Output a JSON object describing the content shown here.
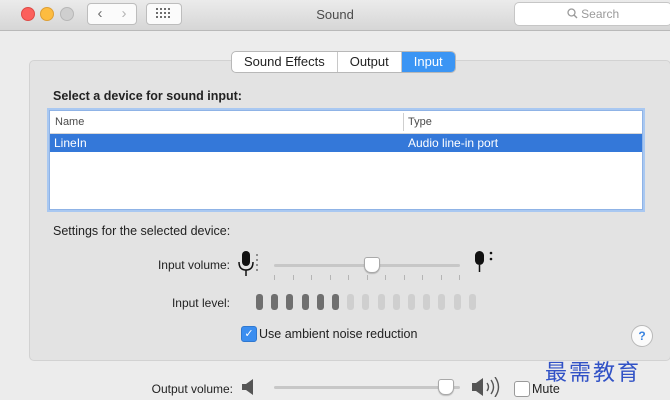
{
  "window": {
    "title": "Sound"
  },
  "search": {
    "placeholder": "Search",
    "icon": "search-icon"
  },
  "tabs": [
    {
      "label": "Sound Effects",
      "active": false
    },
    {
      "label": "Output",
      "active": false
    },
    {
      "label": "Input",
      "active": true
    }
  ],
  "input": {
    "section_title": "Select a device for sound input:",
    "columns": [
      "Name",
      "Type"
    ],
    "devices": [
      {
        "name": "LineIn",
        "type": "Audio line-in port",
        "selected": true
      }
    ],
    "settings_label": "Settings for the selected device:",
    "input_volume_label": "Input volume:",
    "input_volume": 0.52,
    "input_level_label": "Input level:",
    "input_level_segments": 15,
    "input_level_lit": 6,
    "ambient_noise": {
      "label": "Use ambient noise reduction",
      "checked": true
    }
  },
  "output": {
    "label": "Output volume:",
    "volume": 0.92,
    "mute": {
      "label": "Mute",
      "checked": false
    }
  },
  "watermark": "最需教育",
  "colors": {
    "accent": "#3b95f4",
    "selection": "#3478d9",
    "level_on": "#6f6f6f",
    "level_off": "#cfcfcf"
  }
}
